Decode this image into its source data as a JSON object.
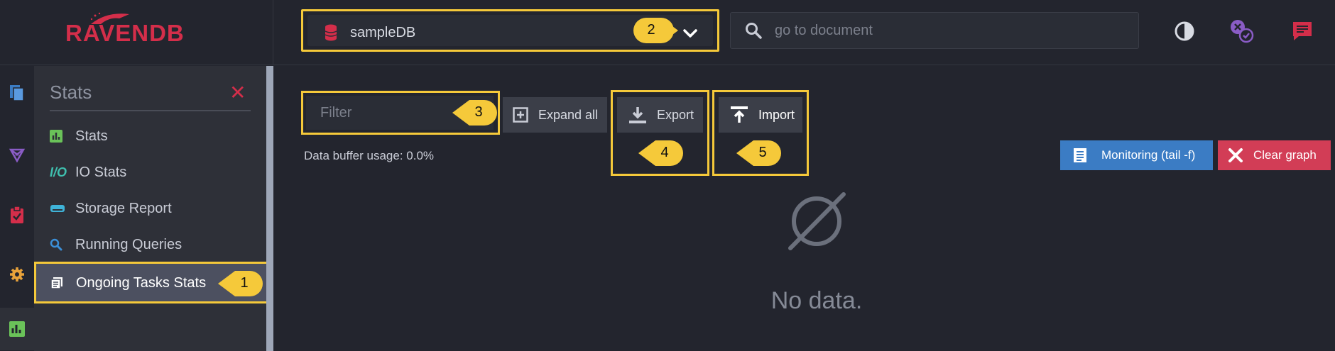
{
  "header": {
    "logo": "RAVENDB",
    "database": "sampleDB",
    "search_placeholder": "go to document"
  },
  "panel": {
    "title": "Stats",
    "items": [
      {
        "label": "Stats",
        "icon": "bar-chart-icon"
      },
      {
        "label": "IO Stats",
        "icon": "io-icon"
      },
      {
        "label": "Storage Report",
        "icon": "storage-icon"
      },
      {
        "label": "Running Queries",
        "icon": "query-icon"
      },
      {
        "label": "Ongoing Tasks Stats",
        "icon": "tasks-icon"
      }
    ]
  },
  "toolbar": {
    "filter_placeholder": "Filter",
    "expand_all": "Expand all",
    "export": "Export",
    "import": "Import",
    "monitoring": "Monitoring (tail -f)",
    "clear_graph": "Clear graph",
    "buffer_usage": "Data buffer usage: 0.0%"
  },
  "main": {
    "empty_text": "No data."
  },
  "callouts": [
    "1",
    "2",
    "3",
    "4",
    "5"
  ],
  "colors": {
    "accent_red": "#d42e4a",
    "highlight_yellow": "#f5c93a",
    "monitor_blue": "#3b7cc4",
    "clear_red": "#d23d56"
  }
}
